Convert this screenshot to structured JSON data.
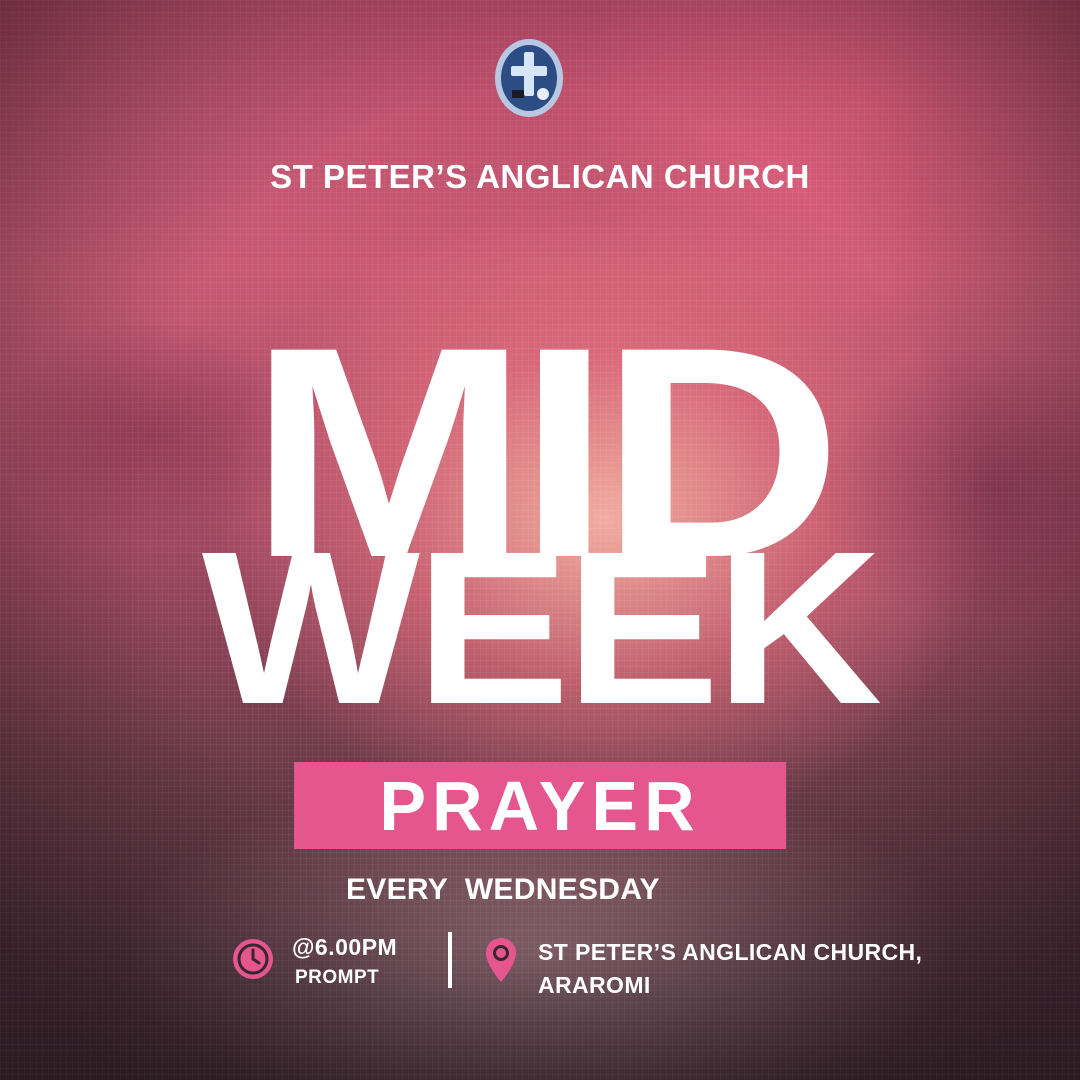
{
  "organization": {
    "name": "ST PETER’S ANGLICAN CHURCH"
  },
  "logo": {
    "icon": "church-crest-logo",
    "colors": {
      "ring": "#c9d6ea",
      "field": "#2c4d83",
      "cross": "#d7e6f6"
    }
  },
  "headline": {
    "line1": "MID",
    "line2": "WEEK"
  },
  "badge": {
    "text": "PRAYER",
    "color": "#e5558e"
  },
  "schedule": {
    "day": "EVERY  WEDNESDAY"
  },
  "time": {
    "icon": "clock-icon",
    "main": "@6.00PM",
    "sub": "PROMPT"
  },
  "location": {
    "icon": "location-pin-icon",
    "line1": "ST PETER’S ANGLICAN CHURCH,",
    "line2": "ARAROMI"
  },
  "accent_color": "#e5558e"
}
